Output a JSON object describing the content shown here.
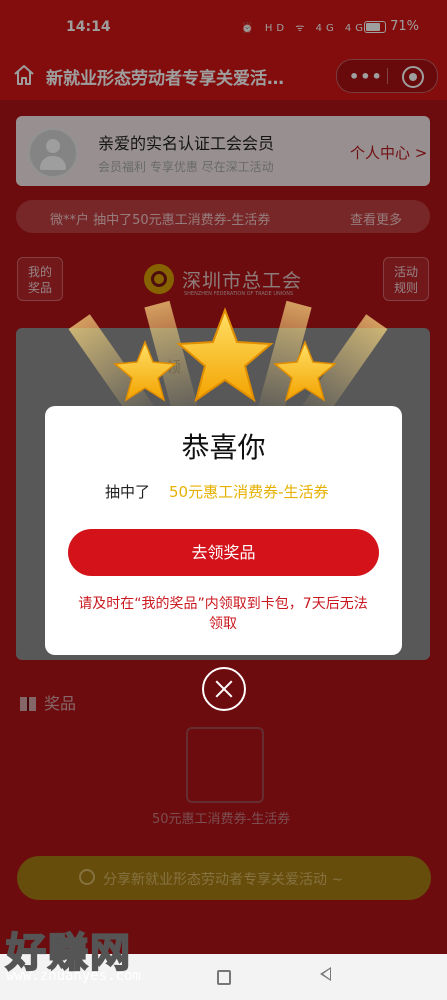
{
  "status_bar": {
    "time": "14:14",
    "icons_text": "⏰ HD ᯤ 4G 4G",
    "battery": "71%"
  },
  "header": {
    "title": "新就业形态劳动者专享关爱活…",
    "more_glyph": "•••"
  },
  "member": {
    "name": "亲爱的实名认证工会会员",
    "desc": "会员福利 专享优惠 尽在深工活动",
    "center_link": "个人中心 >"
  },
  "ticker": {
    "message": "微**户 抽中了50元惠工消费券-生活券",
    "more": "查看更多"
  },
  "side": {
    "my_prize": "我的\n奖品",
    "rules": "活动\n规则"
  },
  "logo": {
    "name": "深圳市总工会",
    "sub": "SHENZHEN FEDERATION OF TRADE UNIONS"
  },
  "panel": {
    "text": "有          领"
  },
  "prizes": {
    "title": "奖品",
    "item": "50元惠工消费券-生活券"
  },
  "share": {
    "label": "分享新就业形态劳动者专享关爱活动 ~"
  },
  "modal": {
    "title": "恭喜你",
    "won_label": "抽中了",
    "prize": "50元惠工消费券-生活券",
    "claim_button": "去领奖品",
    "note": "请及时在“我的奖品”内领取到卡包，7天后无法领取"
  },
  "watermark": {
    "big": "好赚网",
    "small": "www.zhuanyes.com"
  },
  "colors": {
    "brand_red": "#d31515",
    "gold": "#e6b100"
  }
}
